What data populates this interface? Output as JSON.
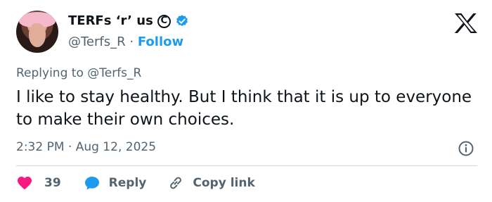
{
  "author": {
    "display_name": "TERFs ‘r’ us",
    "copyright_symbol": "C",
    "handle": "@Terfs_R",
    "separator": "·",
    "follow_label": "Follow"
  },
  "reply_context": {
    "prefix": "Replying to",
    "mention": "@Terfs_R"
  },
  "tweet": {
    "text": "I like to stay healthy. But I think that it is up to everyone to make their own choices.",
    "timestamp": "2:32 PM · Aug 12, 2025"
  },
  "actions": {
    "like_count": "39",
    "reply_label": "Reply",
    "copy_link_label": "Copy link"
  },
  "colors": {
    "accent": "#1d9bf0",
    "like": "#f91880",
    "secondary_text": "#536471",
    "divider": "#cfd9de"
  },
  "icons": {
    "verified": "verified-badge-icon",
    "logo": "x-logo-icon",
    "info": "info-icon",
    "like": "heart-icon",
    "reply": "speech-bubble-icon",
    "copy": "link-icon"
  }
}
